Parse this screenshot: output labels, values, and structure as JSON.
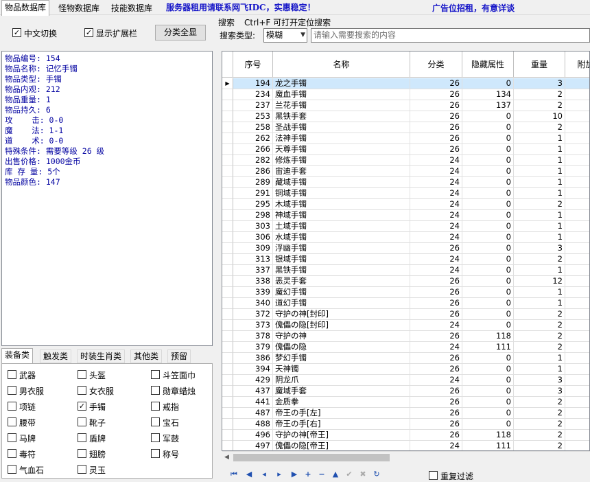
{
  "top_tabs": [
    "物品数据库",
    "怪物数据库",
    "技能数据库"
  ],
  "ad_left": "服务器租用请联系网飞IDC，实惠稳定！",
  "ad_right": "广告位招租，有意详谈",
  "toolbar": {
    "chk_chinese": "中文切换",
    "chk_ext": "显示扩展栏",
    "btn_all": "分类全显"
  },
  "search": {
    "title": "搜索",
    "hint": "Ctrl+F 可打开定位搜索",
    "type_label": "搜索类型:",
    "type_value": "模糊",
    "placeholder": "请输入需要搜索的内容"
  },
  "info": [
    "物品编号: 154",
    "物品名称: 记忆手镯",
    "物品类型: 手镯",
    "物品内观: 212",
    "物品重量: 1",
    "物品持久: 6",
    "攻    击: 0-0",
    "魔    法: 1-1",
    "道    术: 0-0",
    "特殊条件: 需要等级 26 级",
    "出售价格: 1000金币",
    "库 存 量: 5个",
    "物品颜色: 147"
  ],
  "bottom_tabs": [
    "装备类",
    "触发类",
    "时装生肖类",
    "其他类",
    "预留"
  ],
  "categories": [
    {
      "label": "武器",
      "checked": false
    },
    {
      "label": "头盔",
      "checked": false
    },
    {
      "label": "斗笠面巾",
      "checked": false
    },
    {
      "label": "男衣服",
      "checked": false
    },
    {
      "label": "女衣服",
      "checked": false
    },
    {
      "label": "勋章蜡烛",
      "checked": false
    },
    {
      "label": "项链",
      "checked": false
    },
    {
      "label": "手镯",
      "checked": true
    },
    {
      "label": "戒指",
      "checked": false
    },
    {
      "label": "腰带",
      "checked": false
    },
    {
      "label": "靴子",
      "checked": false
    },
    {
      "label": "宝石",
      "checked": false
    },
    {
      "label": "马牌",
      "checked": false
    },
    {
      "label": "盾牌",
      "checked": false
    },
    {
      "label": "军鼓",
      "checked": false
    },
    {
      "label": "毒符",
      "checked": false
    },
    {
      "label": "翅膀",
      "checked": false
    },
    {
      "label": "称号",
      "checked": false
    },
    {
      "label": "气血石",
      "checked": false
    },
    {
      "label": "灵玉",
      "checked": false
    }
  ],
  "grid": {
    "columns": [
      "序号",
      "名称",
      "分类",
      "隐藏属性",
      "重量",
      "附加"
    ],
    "rows": [
      [
        "194",
        "龙之手镯",
        "26",
        "0",
        "3"
      ],
      [
        "234",
        "魔血手镯",
        "26",
        "134",
        "2"
      ],
      [
        "237",
        "兰花手镯",
        "26",
        "137",
        "2"
      ],
      [
        "253",
        "黑铁手套",
        "26",
        "0",
        "10"
      ],
      [
        "258",
        "圣战手镯",
        "26",
        "0",
        "2"
      ],
      [
        "262",
        "法神手镯",
        "26",
        "0",
        "1"
      ],
      [
        "266",
        "天尊手镯",
        "26",
        "0",
        "1"
      ],
      [
        "282",
        "修炼手镯",
        "24",
        "0",
        "1"
      ],
      [
        "286",
        "宙迪手套",
        "24",
        "0",
        "1"
      ],
      [
        "289",
        "藏域手镯",
        "24",
        "0",
        "1"
      ],
      [
        "291",
        "铜域手镯",
        "24",
        "0",
        "1"
      ],
      [
        "295",
        "木域手镯",
        "24",
        "0",
        "2"
      ],
      [
        "298",
        "神域手镯",
        "24",
        "0",
        "1"
      ],
      [
        "303",
        "土域手镯",
        "24",
        "0",
        "1"
      ],
      [
        "306",
        "水域手镯",
        "24",
        "0",
        "1"
      ],
      [
        "309",
        "浮幽手镯",
        "26",
        "0",
        "3"
      ],
      [
        "313",
        "银域手镯",
        "24",
        "0",
        "2"
      ],
      [
        "337",
        "黑铁手镯",
        "24",
        "0",
        "1"
      ],
      [
        "338",
        "恶灵手套",
        "26",
        "0",
        "12"
      ],
      [
        "339",
        "魔幻手镯",
        "26",
        "0",
        "1"
      ],
      [
        "340",
        "道幻手镯",
        "26",
        "0",
        "1"
      ],
      [
        "372",
        "守护の神[封印]",
        "26",
        "0",
        "2"
      ],
      [
        "373",
        "傀儡の隐[封印]",
        "24",
        "0",
        "2"
      ],
      [
        "378",
        "守护の神",
        "26",
        "118",
        "2"
      ],
      [
        "379",
        "傀儡の隐",
        "24",
        "111",
        "2"
      ],
      [
        "386",
        "梦幻手镯",
        "26",
        "0",
        "1"
      ],
      [
        "394",
        "天神镯",
        "26",
        "0",
        "1"
      ],
      [
        "429",
        "阴龙爪",
        "24",
        "0",
        "3"
      ],
      [
        "437",
        "魔域手套",
        "26",
        "0",
        "3"
      ],
      [
        "441",
        "金质拳",
        "26",
        "0",
        "2"
      ],
      [
        "487",
        "帝王の手[左]",
        "26",
        "0",
        "2"
      ],
      [
        "488",
        "帝王の手[右]",
        "26",
        "0",
        "2"
      ],
      [
        "496",
        "守护の神[帝王]",
        "26",
        "118",
        "2"
      ],
      [
        "497",
        "傀儡の隐[帝王]",
        "24",
        "111",
        "2"
      ]
    ]
  },
  "filter_label": "重复过滤"
}
